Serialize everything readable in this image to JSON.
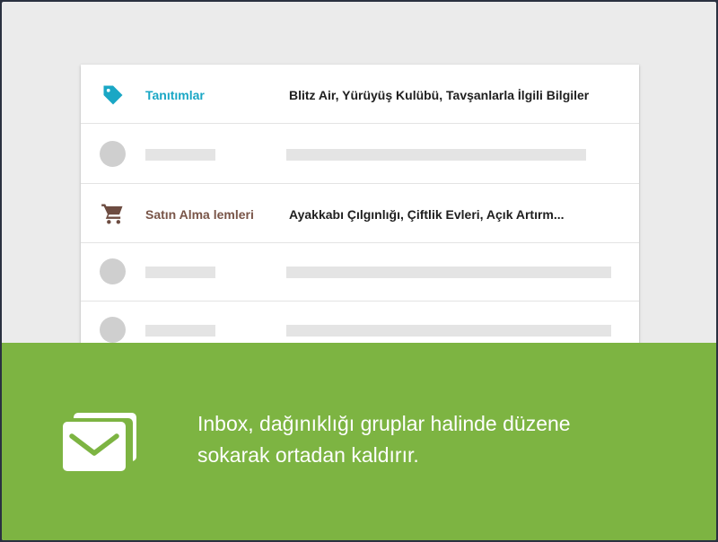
{
  "inbox_preview": {
    "rows": [
      {
        "type": "bundle",
        "icon": "tag-icon",
        "label": "Tanıtımlar",
        "label_color": "#1aa7c5",
        "subject": "Blitz Air, Yürüyüş Kulübü, Tavşanlarla İlgili Bilgiler"
      },
      {
        "type": "placeholder"
      },
      {
        "type": "bundle",
        "icon": "shopping-cart-icon",
        "label": "Satın Alma lemleri",
        "label_color": "#795548",
        "subject": "Ayakkabı Çılgınlığı, Çiftlik Evleri, Açık Artırm..."
      },
      {
        "type": "placeholder"
      },
      {
        "type": "placeholder"
      }
    ]
  },
  "banner": {
    "background": "#7db442",
    "icon": "stacked-mail-icon",
    "line1": "Inbox, dağınıklığı gruplar halinde düzene",
    "line2": "sokarak ortadan kaldırır."
  }
}
